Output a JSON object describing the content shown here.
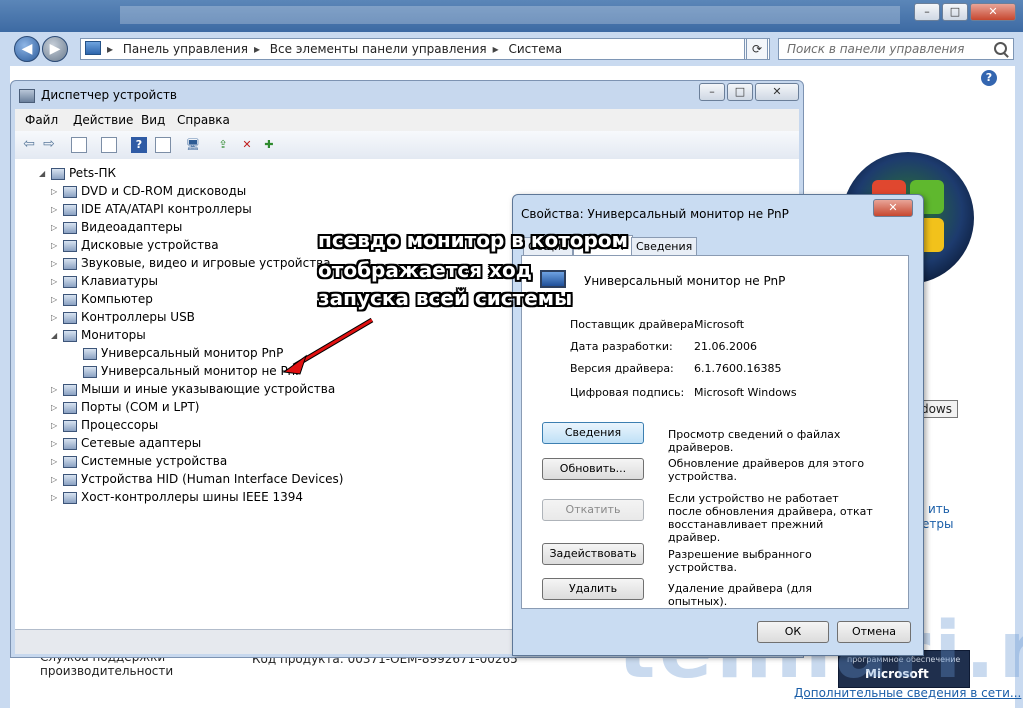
{
  "breadcrumbs": [
    "Панель управления",
    "Все элементы панели управления",
    "Система"
  ],
  "search": {
    "placeholder": "Поиск в панели управления"
  },
  "cp": {
    "footer_left_1": "Служба поддержки",
    "footer_left_2": "производительности",
    "product_code": "Код продукта: 00371-OEM-8992671-00265",
    "link_1": "ить",
    "link_2": "етры",
    "ms_label_1": "программное обеспечение",
    "ms_label_2": "Microsoft",
    "more_link": "Дополнительные сведения в сети..."
  },
  "watermark": "tehnari.ru",
  "device_manager": {
    "title": "Диспетчер устройств",
    "menu": [
      "Файл",
      "Действие",
      "Вид",
      "Справка"
    ],
    "tree": {
      "root": "Pets-ПК",
      "items": [
        "DVD и CD-ROM дисководы",
        "IDE ATA/ATAPI контроллеры",
        "Видеоадаптеры",
        "Дисковые устройства",
        "Звуковые, видео и игровые устройства",
        "Клавиатуры",
        "Компьютер",
        "Контроллеры USB",
        "Мониторы",
        "Универсальный монитор PnP",
        "Универсальный монитор не PnP",
        "Мыши и иные указывающие устройства",
        "Порты (COM и LPT)",
        "Процессоры",
        "Сетевые адаптеры",
        "Системные устройства",
        "Устройства HID (Human Interface Devices)",
        "Хост-контроллеры шины IEEE 1394"
      ]
    }
  },
  "properties": {
    "title": "Свойства: Универсальный монитор не PnP",
    "tabs": [
      "Общие",
      "Драйвер",
      "Сведения"
    ],
    "device_name": "Универсальный монитор не PnP",
    "fields": [
      {
        "label": "Поставщик драйвера:",
        "value": "Microsoft"
      },
      {
        "label": "Дата разработки:",
        "value": "21.06.2006"
      },
      {
        "label": "Версия драйвера:",
        "value": "6.1.7600.16385"
      },
      {
        "label": "Цифровая подпись:",
        "value": "Microsoft Windows"
      }
    ],
    "actions": [
      {
        "button": "Сведения",
        "desc": "Просмотр сведений о файлах драйверов."
      },
      {
        "button": "Обновить...",
        "desc": "Обновление драйверов для этого устройства."
      },
      {
        "button": "Откатить",
        "desc": "Если устройство не работает после обновления драйвера, откат восстанавливает прежний драйвер."
      },
      {
        "button": "Задействовать",
        "desc": "Разрешение выбранного устройства."
      },
      {
        "button": "Удалить",
        "desc": "Удаление драйвера (для опытных)."
      }
    ],
    "ok": "ОК",
    "cancel": "Отмена"
  },
  "tooltip": "Microsoft Windows",
  "annotation": [
    "псевдо монитор в котором",
    "отображается ход",
    "запуска всей системы"
  ]
}
